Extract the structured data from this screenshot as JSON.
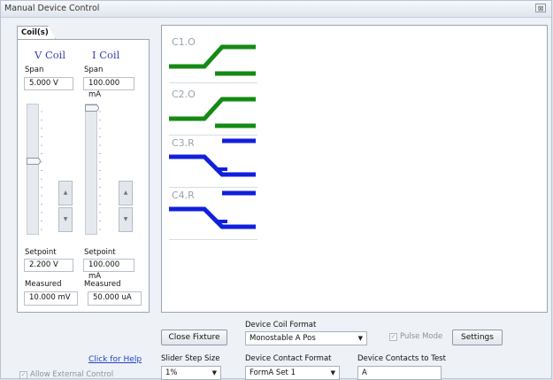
{
  "window": {
    "title": "Manual Device Control",
    "close_glyph": "⊠"
  },
  "coil_tab": {
    "label": "Coil(s)"
  },
  "v_coil": {
    "heading": "V Coil",
    "span_label": "Span",
    "span_value": "5.000  V",
    "setpoint_label": "Setpoint",
    "setpoint_value": "2.200  V",
    "measured_label": "Measured",
    "measured_value": "10.000 mV",
    "slider_level": 0.57
  },
  "i_coil": {
    "heading": "I Coil",
    "span_label": "Span",
    "span_value": "100.000 mA",
    "setpoint_label": "Setpoint",
    "setpoint_value": "100.000 mA",
    "measured_label": "Measured",
    "measured_value": "50.000 uA",
    "slider_level": 1.0
  },
  "step_icons": {
    "up": "▲",
    "down": "▼"
  },
  "contacts": [
    {
      "label": "C1.O",
      "color": "#158a15",
      "state": "open"
    },
    {
      "label": "C2.O",
      "color": "#158a15",
      "state": "open"
    },
    {
      "label": "C3.R",
      "color": "#1020dd",
      "state": "relaxed"
    },
    {
      "label": "C4.R",
      "color": "#1020dd",
      "state": "relaxed"
    }
  ],
  "controls": {
    "close_fixture": "Close Fixture",
    "coil_format_label": "Device Coil Format",
    "coil_format_value": "Monostable A Pos",
    "pulse_mode_label": "Pulse Mode",
    "pulse_mode_checked": true,
    "settings": "Settings",
    "help_link": "Click for Help",
    "step_size_label": "Slider Step Size",
    "step_size_value": "1%",
    "contact_format_label": "Device Contact Format",
    "contact_format_value": "FormA Set 1",
    "contacts_to_test_label": "Device Contacts to Test",
    "contacts_to_test_value": "A",
    "allow_external_label": "Allow External Control",
    "allow_external_checked": true,
    "dropdown_arrow": "▼",
    "check_glyph": "✓"
  }
}
